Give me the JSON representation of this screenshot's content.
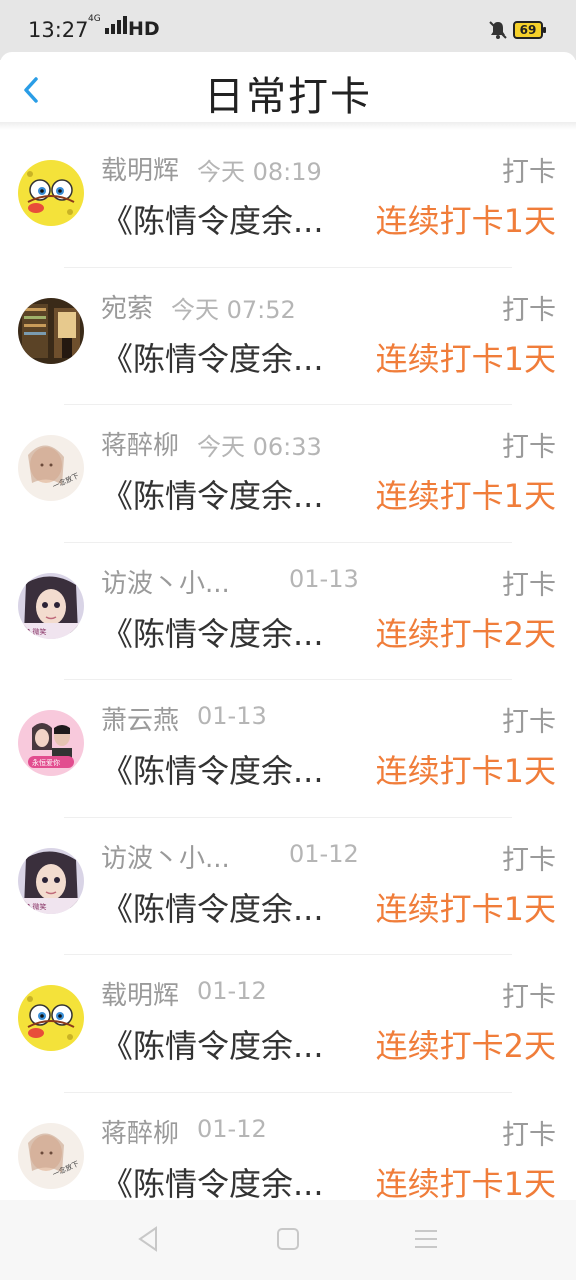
{
  "status_bar": {
    "time": "13:27",
    "network": "4G",
    "hd": "HD",
    "battery": "69"
  },
  "header": {
    "title": "日常打卡",
    "back_icon": "chevron-left-icon"
  },
  "accent_color": "#f07d3a",
  "list": [
    {
      "name": "载明辉",
      "time": "今天 08:19",
      "tag": "打卡",
      "title": "《陈情令度余...",
      "streak": "连续打卡1天",
      "avatar": "sponge-cartoon"
    },
    {
      "name": "宛萦",
      "time": "今天 07:52",
      "tag": "打卡",
      "title": "《陈情令度余...",
      "streak": "连续打卡1天",
      "avatar": "bookstore-photo"
    },
    {
      "name": "蒋醉柳",
      "time": "今天 06:33",
      "tag": "打卡",
      "title": "《陈情令度余...",
      "streak": "连续打卡1天",
      "avatar": "girl-soft-photo"
    },
    {
      "name": "访波丶小...",
      "time": "01-13",
      "tag": "打卡",
      "title": "《陈情令度余...",
      "streak": "连续打卡2天",
      "avatar": "girl-dark-hair"
    },
    {
      "name": "萧云燕",
      "time": "01-13",
      "tag": "打卡",
      "title": "《陈情令度余...",
      "streak": "连续打卡1天",
      "avatar": "couple-pink"
    },
    {
      "name": "访波丶小...",
      "time": "01-12",
      "tag": "打卡",
      "title": "《陈情令度余...",
      "streak": "连续打卡1天",
      "avatar": "girl-dark-hair"
    },
    {
      "name": "载明辉",
      "time": "01-12",
      "tag": "打卡",
      "title": "《陈情令度余...",
      "streak": "连续打卡2天",
      "avatar": "sponge-cartoon"
    },
    {
      "name": "蒋醉柳",
      "time": "01-12",
      "tag": "打卡",
      "title": "《陈情令度余...",
      "streak": "连续打卡1天",
      "avatar": "girl-soft-photo"
    }
  ],
  "nav": {
    "back": "triangle-back-icon",
    "home": "square-home-icon",
    "menu": "menu-lines-icon"
  }
}
